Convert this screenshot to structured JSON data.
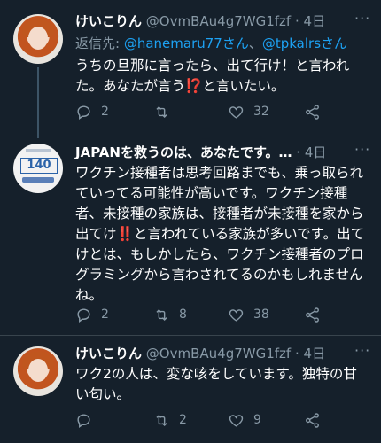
{
  "tweets": [
    {
      "name": "けいこりん",
      "handle": "@OvmBAu4g7WG1fzf",
      "dot": "·",
      "date": "4日",
      "reply_prefix": "返信先: ",
      "reply_user1": "@hanemaru77さん",
      "reply_sep": "、",
      "reply_user2": "@tpkalrsさん",
      "text_a": "うちの旦那に言ったら、出て行け！と言われた。あなたが言う",
      "bang": "⁉️",
      "text_b": "と言いたい。",
      "replies": "2",
      "retweets": "",
      "likes": "32"
    },
    {
      "name": "JAPANを救うのは、あなたです。…",
      "avatar_number": "140",
      "dot": "·",
      "date": "4日",
      "text_a": "ワクチン接種者は思考回路までも、乗っ取られていってる可能性が高いです。ワクチン接種者、未接種の家族は、接種者が未接種を家から出てけ",
      "bang": "‼️",
      "text_b": "と言われている家族が多いです。出てけとは、もしかしたら、ワクチン接種者のプログラミングから言わされてるのかもしれませんね。",
      "replies": "2",
      "retweets": "8",
      "likes": "38"
    },
    {
      "name": "けいこりん",
      "handle": "@OvmBAu4g7WG1fzf",
      "dot": "·",
      "date": "4日",
      "text_a": "ワク2の人は、変な咳をしています。独特の甘い匂い。",
      "replies": "",
      "retweets": "2",
      "likes": "9"
    }
  ],
  "icons": {
    "more": "more-icon",
    "reply": "reply-icon",
    "retweet": "retweet-icon",
    "like": "heart-icon",
    "share": "share-icon"
  },
  "colors": {
    "background": "#15202b",
    "secondary_text": "#8899a6",
    "link": "#1da1f2",
    "divider": "#38444d"
  }
}
